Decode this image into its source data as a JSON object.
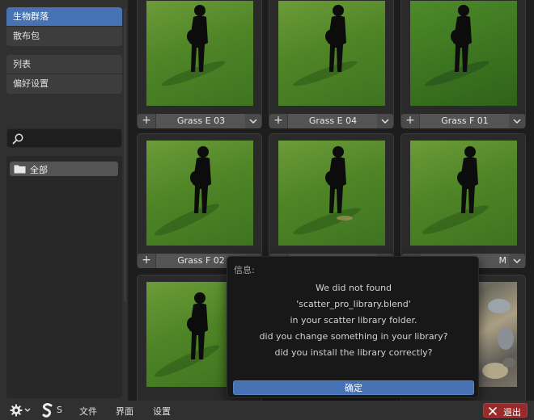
{
  "sidebar": {
    "group1": [
      "生物群落",
      "散布包"
    ],
    "group2": [
      "列表",
      "偏好设置"
    ],
    "search": {
      "value": "",
      "placeholder": ""
    },
    "tree": {
      "label": "全部",
      "icon": "folder-icon"
    }
  },
  "grid": {
    "items": [
      {
        "name": "Grass E 03",
        "type": "grass"
      },
      {
        "name": "Grass E 04",
        "type": "grass"
      },
      {
        "name": "Grass F 01",
        "type": "grass"
      },
      {
        "name": "Grass F 02",
        "type": "grass"
      },
      {
        "name": "",
        "type": "grass"
      },
      {
        "name": "M",
        "type": "grass"
      },
      {
        "name": "",
        "type": "grass"
      },
      {
        "name": "",
        "type": "rock"
      }
    ]
  },
  "popup": {
    "title": "信息:",
    "lines": [
      "We did not found",
      "'scatter_pro_library.blend'",
      "in your scatter library folder.",
      "did you change something in your library?",
      "did you install the library correctly?"
    ],
    "ok_label": "确定"
  },
  "bottombar": {
    "logo_label": "S",
    "menu": [
      "文件",
      "界面",
      "设置"
    ],
    "exit_label": "退出"
  },
  "colors": {
    "accent": "#4772b3",
    "danger": "#9a2a2a",
    "background": "#1d1d1d",
    "panel": "#303030"
  }
}
